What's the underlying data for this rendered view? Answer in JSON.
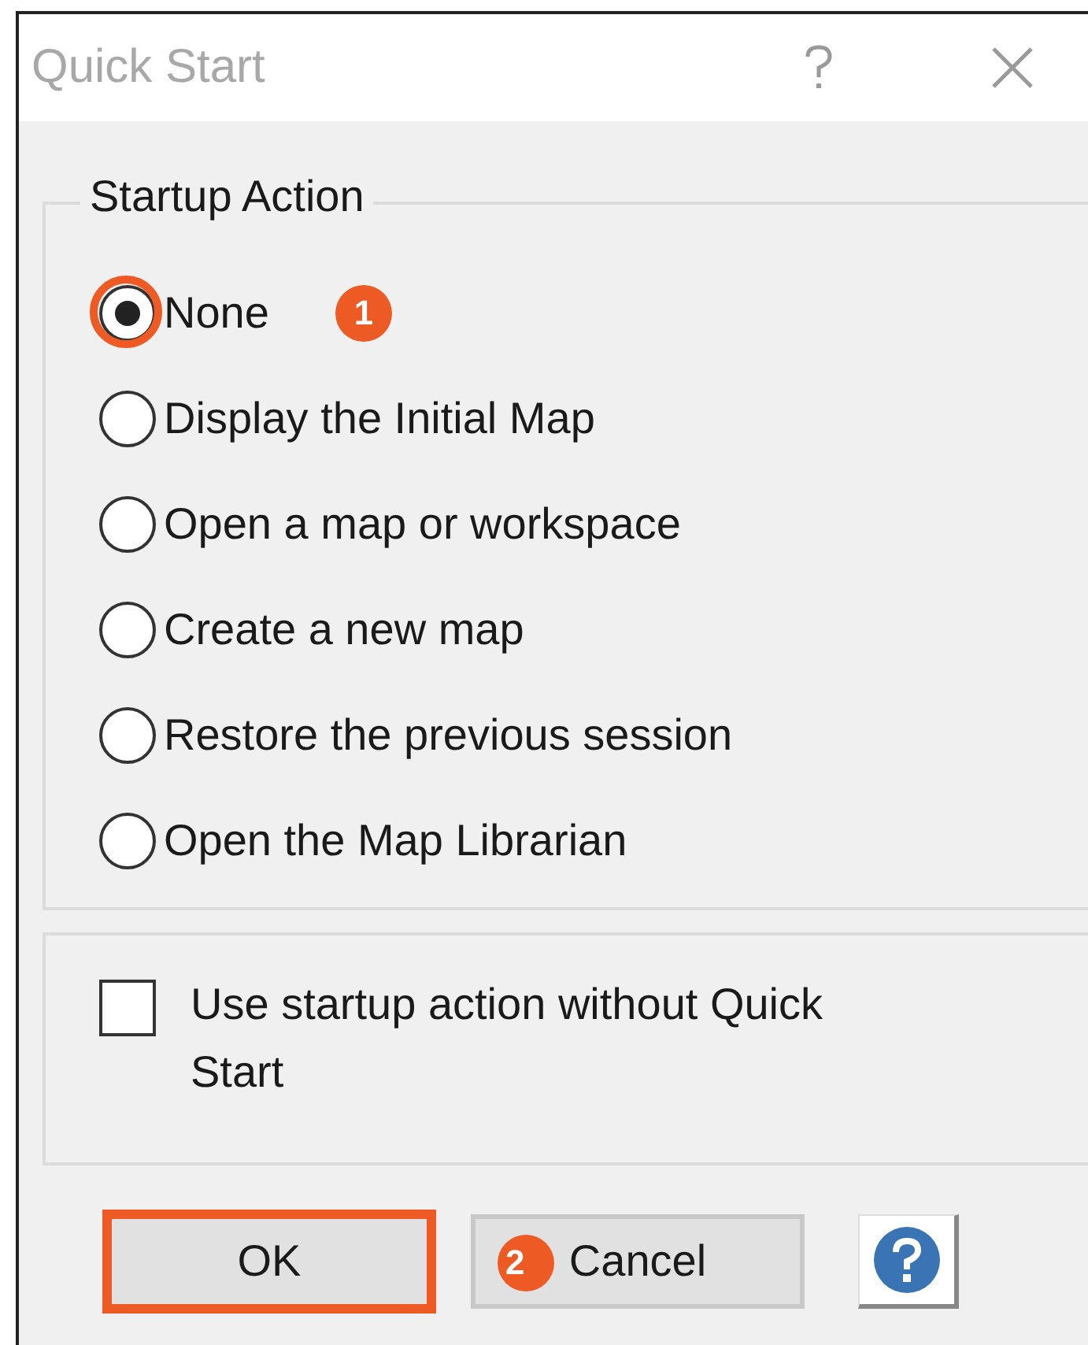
{
  "window": {
    "title": "Quick Start"
  },
  "startup_action": {
    "legend": "Startup Action",
    "options": [
      {
        "label": "None",
        "selected": true,
        "highlighted": true,
        "step": "1"
      },
      {
        "label": "Display the Initial Map",
        "selected": false,
        "highlighted": false
      },
      {
        "label": "Open a map or workspace",
        "selected": false,
        "highlighted": false
      },
      {
        "label": "Create a new map",
        "selected": false,
        "highlighted": false
      },
      {
        "label": "Restore the previous session",
        "selected": false,
        "highlighted": false
      },
      {
        "label": "Open the Map Librarian",
        "selected": false,
        "highlighted": false
      }
    ]
  },
  "option": {
    "label": "Use startup action without Quick Start",
    "checked": false
  },
  "buttons": [
    {
      "kind": "text",
      "label": "OK",
      "highlighted": true
    },
    {
      "kind": "text",
      "label": "Cancel",
      "highlighted": false,
      "step": "2"
    },
    {
      "kind": "help"
    }
  ]
}
